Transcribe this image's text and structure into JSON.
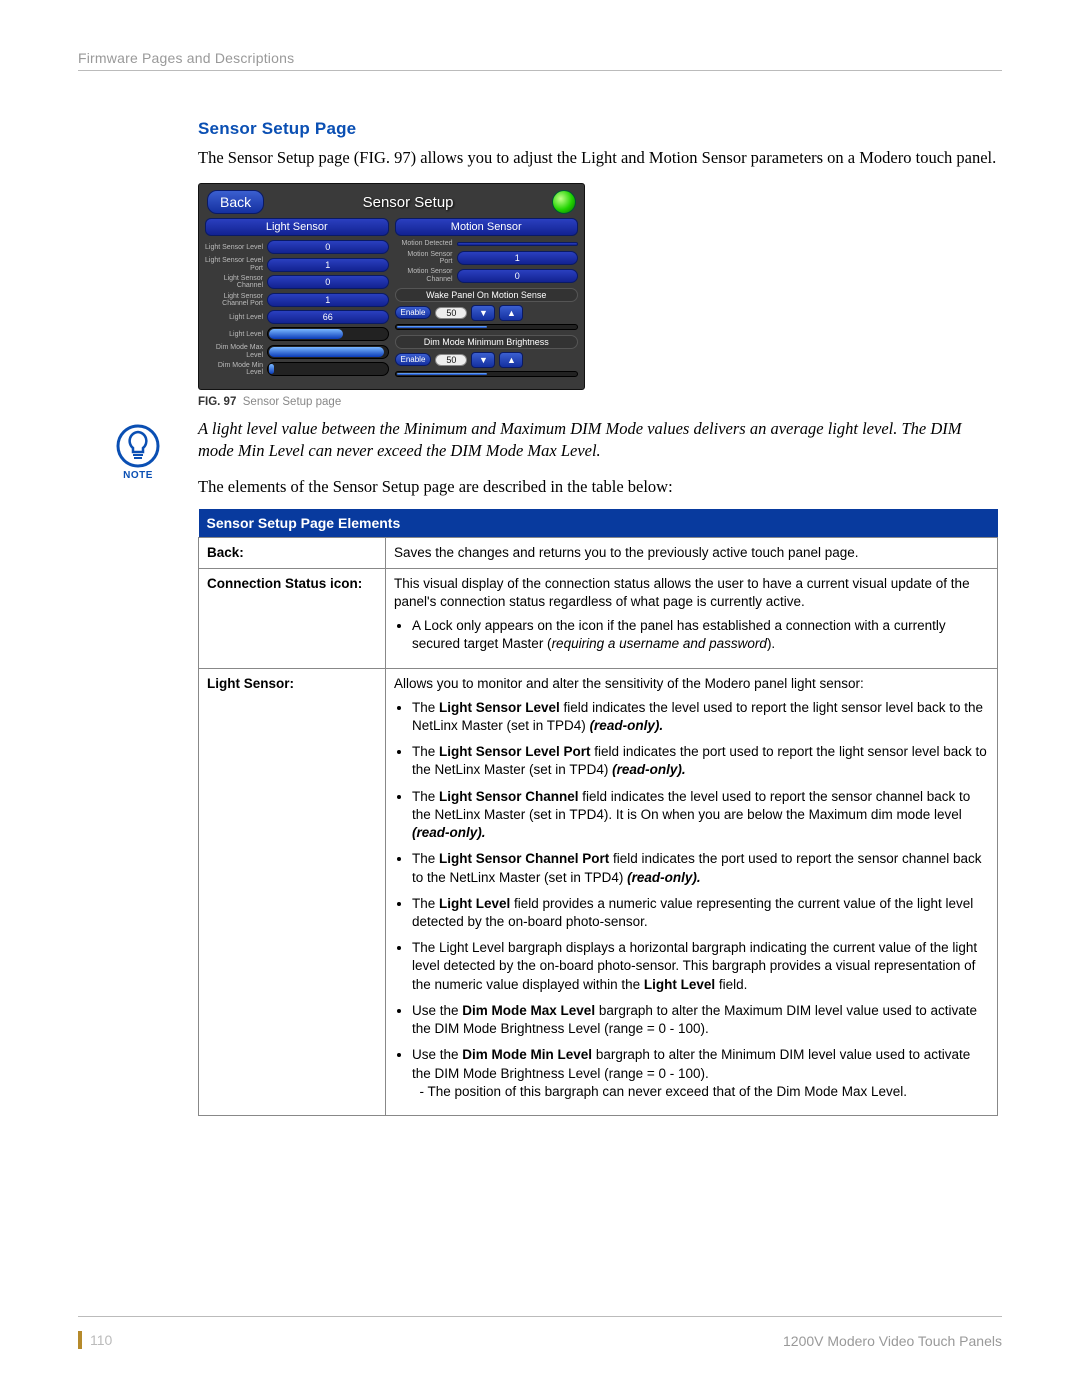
{
  "header": "Firmware Pages and Descriptions",
  "section_title": "Sensor Setup Page",
  "intro": "The Sensor Setup page (FIG. 97) allows you to adjust the Light and Motion Sensor parameters on a Modero touch panel.",
  "figure": {
    "back": "Back",
    "title": "Sensor Setup",
    "left_head": "Light Sensor",
    "right_head": "Motion Sensor",
    "left_rows": [
      {
        "label": "Light Sensor Level",
        "value": "0"
      },
      {
        "label": "Light Sensor Level Port",
        "value": "1"
      },
      {
        "label": "Light Sensor Channel",
        "value": "0"
      },
      {
        "label": "Light Sensor Channel Port",
        "value": "1"
      },
      {
        "label": "Light Level",
        "value": "66"
      }
    ],
    "left_bar_labels": [
      "Light Level",
      "Dim Mode Max Level",
      "Dim Mode Min Level"
    ],
    "right_rows": [
      {
        "label": "Motion Detected",
        "value": ""
      },
      {
        "label": "Motion Sensor Port",
        "value": "1"
      },
      {
        "label": "Motion Sensor Channel",
        "value": "0"
      }
    ],
    "wake_head": "Wake Panel On Motion Sense",
    "dim_head": "Dim Mode Minimum Brightness",
    "enable": "Enable",
    "val50a": "50",
    "val50b": "50",
    "caption_bold": "FIG. 97",
    "caption_rest": "Sensor Setup page"
  },
  "note": {
    "label": "NOTE",
    "text": "A light level value between the Minimum and Maximum DIM Mode values delivers an average light level. The DIM mode Min Level can never exceed the DIM Mode Max Level."
  },
  "lead_out": "The elements of the Sensor Setup page are described in the table below:",
  "table": {
    "title": "Sensor Setup Page Elements",
    "rows": {
      "back": {
        "k": "Back:",
        "v": "Saves the changes and returns you to the previously active touch panel page."
      },
      "conn": {
        "k": "Connection Status icon:",
        "para": "This visual display of the connection status allows the user to have a current visual update of the panel's connection status regardless of what page is currently active.",
        "b1a": "A Lock only appears on the icon if the panel has established a connection with a currently secured target Master (",
        "b1b": "requiring a username and password",
        "b1c": ")."
      },
      "light": {
        "k": "Light Sensor:",
        "para": "Allows you to monitor and alter the sensitivity of the Modero panel light sensor:",
        "b1": {
          "pre": "The ",
          "bold": "Light Sensor Level",
          "post": " field indicates the level used to report the light sensor level back to the NetLinx Master (set in TPD4) ",
          "tail": "(read-only)."
        },
        "b2": {
          "pre": "The ",
          "bold": "Light Sensor Level Port",
          "post": " field indicates the port used to report the light sensor level back to the NetLinx Master (set in TPD4) ",
          "tail": "(read-only)."
        },
        "b3": {
          "pre": "The ",
          "bold": "Light Sensor Channel",
          "post": " field indicates the level used to report the sensor channel back to the NetLinx Master (set in TPD4). It is On when you are below the Maximum dim mode level ",
          "tail": "(read-only)."
        },
        "b4": {
          "pre": "The ",
          "bold": "Light Sensor Channel Port",
          "post": " field indicates the port used to report the sensor channel back to the NetLinx Master (set in TPD4) ",
          "tail": "(read-only)."
        },
        "b5": {
          "pre": "The ",
          "bold": "Light Level",
          "post": " field provides a numeric value representing the current value of the light level detected by the on-board photo-sensor."
        },
        "b6": {
          "text": "The Light Level bargraph displays a horizontal bargraph indicating the current value of the light level detected by the on-board photo-sensor. This bargraph provides a visual representation of the numeric value displayed within the ",
          "bold": "Light Level",
          "post": " field."
        },
        "b7": {
          "pre": "Use the ",
          "bold": "Dim Mode Max Level",
          "post": " bargraph to alter the Maximum DIM level value used to activate the DIM Mode Brightness Level (range = 0 - 100)."
        },
        "b8": {
          "pre": "Use the ",
          "bold": "Dim Mode Min Level",
          "post": " bargraph to alter the Minimum DIM level value used to activate the DIM Mode Brightness Level (range = 0 - 100).",
          "sub": "- The position of this bargraph can never exceed that of the Dim Mode Max Level."
        }
      }
    }
  },
  "footer": {
    "page": "110",
    "right": "1200V Modero Video Touch Panels"
  }
}
